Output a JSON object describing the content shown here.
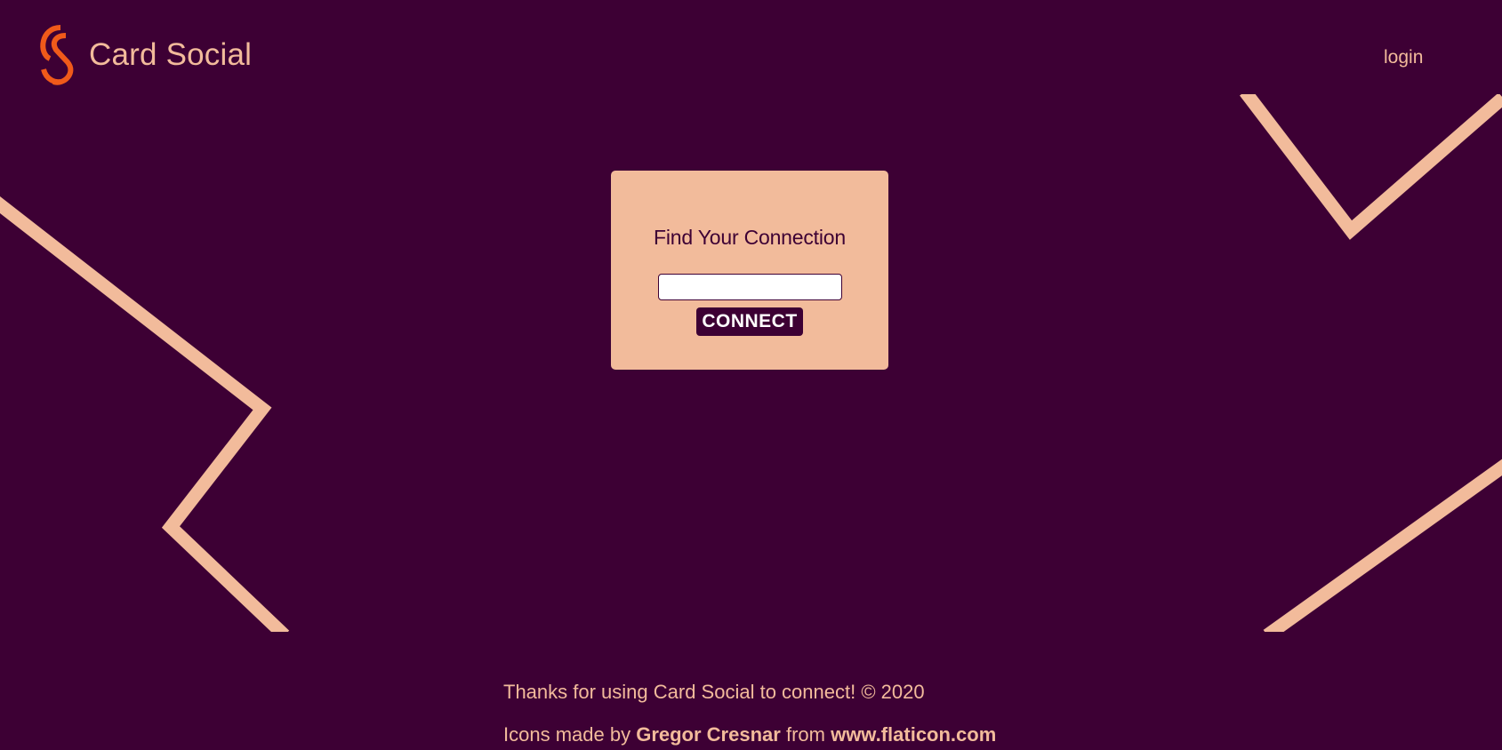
{
  "header": {
    "logo_text": "Card Social",
    "login_label": "login"
  },
  "card": {
    "title": "Find Your Connection",
    "input_value": "",
    "input_placeholder": "",
    "button_label": "CONNECT"
  },
  "footer": {
    "thanks_text": "Thanks for using Card Social to connect! © 2020",
    "credit_prefix": "Icons made by",
    "author_link": "Gregor Cresnar",
    "credit_middle": "from",
    "site_link": "www.flaticon.com"
  },
  "icons": {
    "logo": "cs-logo-icon"
  },
  "colors": {
    "background": "#3d0034",
    "accent": "#f2bb9b",
    "logo_orange": "#f05a1a",
    "button_text": "#ffffff"
  }
}
